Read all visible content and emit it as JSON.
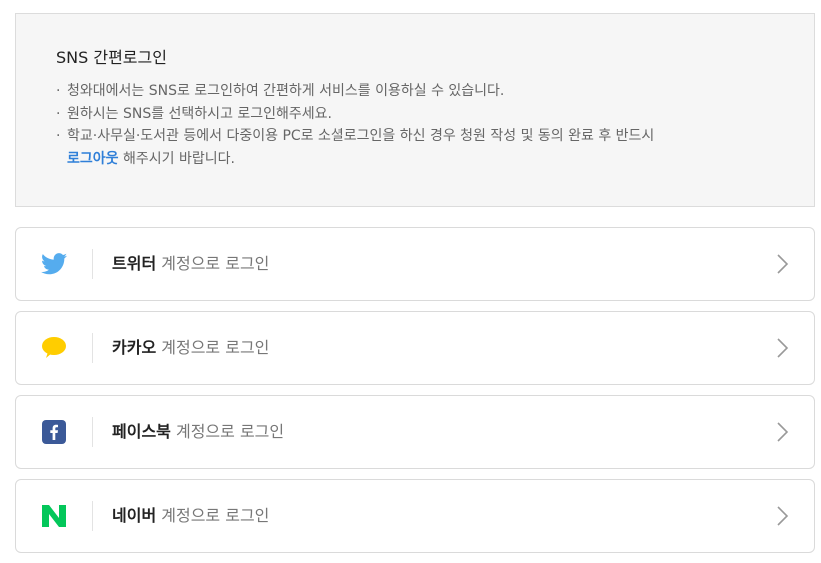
{
  "info": {
    "title": "SNS 간편로그인",
    "bullet": "·",
    "line1": "청와대에서는 SNS로 로그인하여 간편하게 서비스를 이용하실 수 있습니다.",
    "line2": "원하시는 SNS를 선택하시고 로그인해주세요.",
    "line3_part1": "학교·사무실·도서관 등에서 다중이용 PC로 소셜로그인을 하신 경우 청원 작성 및 동의 완료 후 반드시",
    "line3_link": "로그아웃",
    "line3_part2": " 해주시기 바랍니다."
  },
  "login_suffix": " 계정으로 로그인",
  "buttons": [
    {
      "brand": "트위터",
      "icon": "twitter-icon",
      "color": "#55acee"
    },
    {
      "brand": "카카오",
      "icon": "kakao-icon",
      "color": "#ffcd00"
    },
    {
      "brand": "페이스북",
      "icon": "facebook-icon",
      "color": "#3b5998"
    },
    {
      "brand": "네이버",
      "icon": "naver-icon",
      "color": "#03c75a"
    }
  ]
}
